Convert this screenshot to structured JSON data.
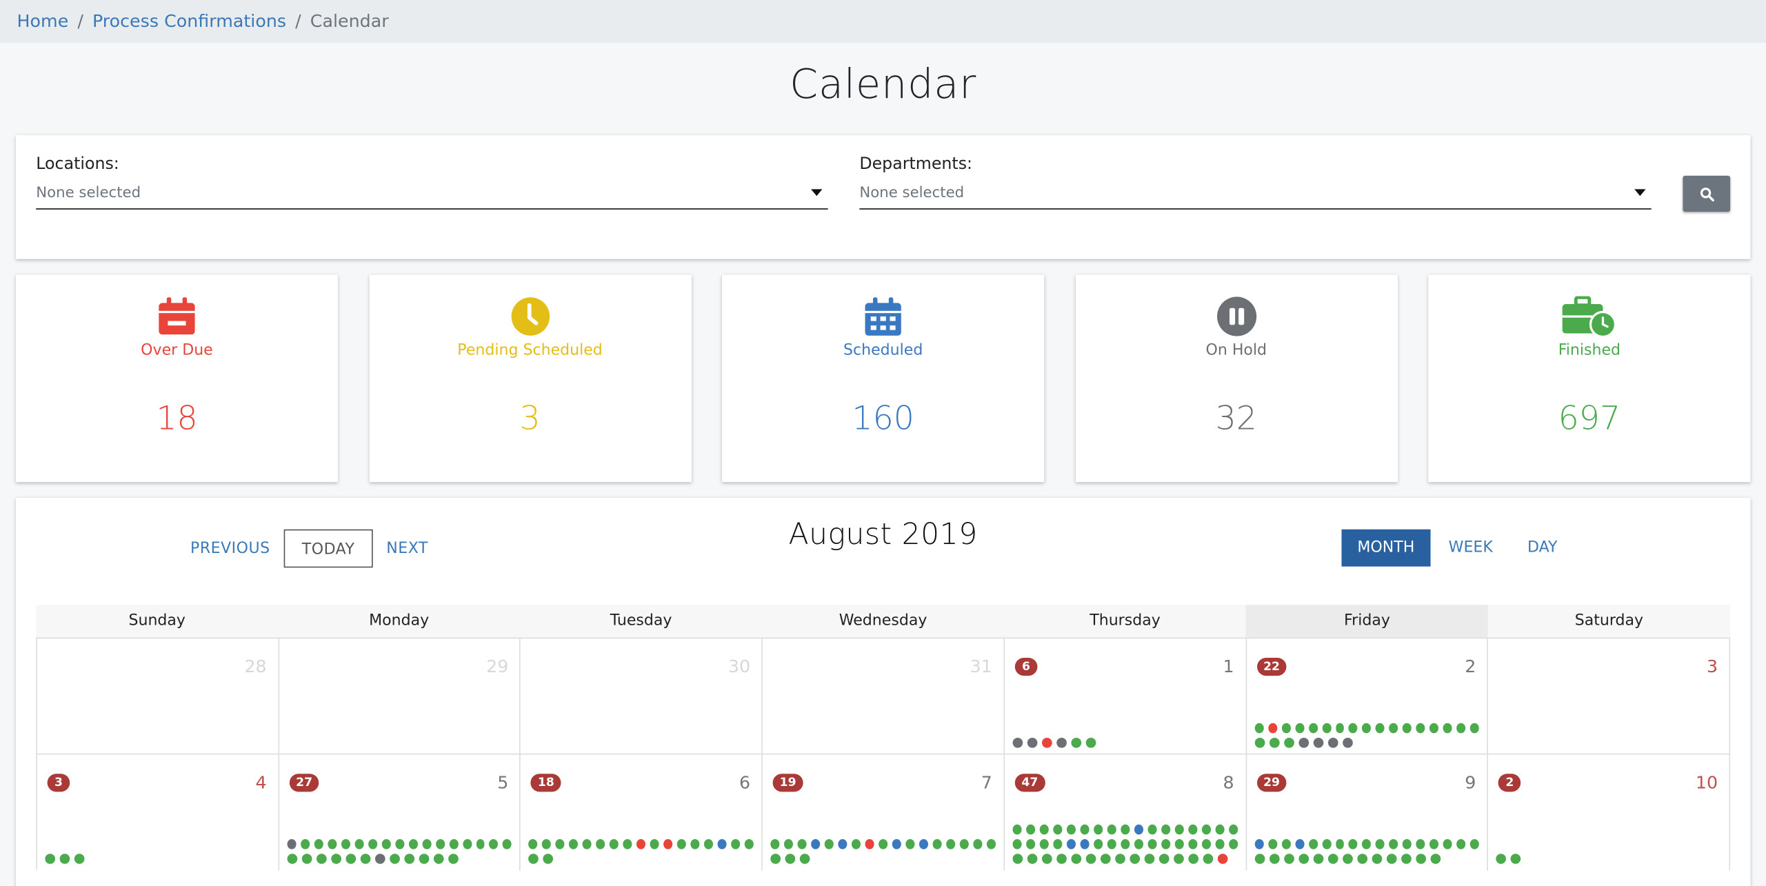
{
  "breadcrumb": {
    "home": "Home",
    "process": "Process Confirmations",
    "current": "Calendar",
    "sep": "/"
  },
  "page_title": "Calendar",
  "filters": {
    "locations": {
      "label": "Locations:",
      "value": "None selected"
    },
    "departments": {
      "label": "Departments:",
      "value": "None selected"
    }
  },
  "stats": [
    {
      "label": "Over Due",
      "value": "18",
      "color": "#e8443a",
      "icon": "calendar-minus-icon"
    },
    {
      "label": "Pending Scheduled",
      "value": "3",
      "color": "#e2be16",
      "icon": "clock-icon"
    },
    {
      "label": "Scheduled",
      "value": "160",
      "color": "#3a78c2",
      "icon": "calendar-grid-icon"
    },
    {
      "label": "On Hold",
      "value": "32",
      "color": "#6c6f73",
      "icon": "pause-icon"
    },
    {
      "label": "Finished",
      "value": "697",
      "color": "#4aaa4c",
      "icon": "briefcase-clock-icon"
    }
  ],
  "calendar": {
    "nav": {
      "previous": "PREVIOUS",
      "today": "TODAY",
      "next": "NEXT"
    },
    "title": "August 2019",
    "views": {
      "month": "MONTH",
      "week": "WEEK",
      "day": "DAY",
      "active": "month"
    },
    "weekdays": [
      "Sunday",
      "Monday",
      "Tuesday",
      "Wednesday",
      "Thursday",
      "Friday",
      "Saturday"
    ],
    "highlighted_weekday": "Friday",
    "dot_colors": {
      "g": "#4aaa4c",
      "r": "#e8443a",
      "b": "#3a78c2",
      "k": "#6c6f73"
    },
    "weeks": [
      [
        {
          "num": "28",
          "other": true
        },
        {
          "num": "29",
          "other": true
        },
        {
          "num": "30",
          "other": true
        },
        {
          "num": "31",
          "other": true
        },
        {
          "num": "1",
          "badge": "6",
          "dots": [
            "kkrkgg"
          ]
        },
        {
          "num": "2",
          "badge": "22",
          "dots": [
            "grggggggggggggggg",
            "gggkkkk"
          ]
        },
        {
          "num": "3",
          "weekend": true
        }
      ],
      [
        {
          "num": "4",
          "weekend": true,
          "badge": "3",
          "dots": [
            "ggg"
          ]
        },
        {
          "num": "5",
          "badge": "27",
          "dots": [
            "kgggggggggggggggg",
            "ggggggkggggg"
          ]
        },
        {
          "num": "6",
          "badge": "18",
          "dots": [
            "ggggggggrgrgggbgg",
            "gg"
          ]
        },
        {
          "num": "7",
          "badge": "19",
          "dots": [
            "gggbgbgrgbgbggggg",
            "ggg"
          ]
        },
        {
          "num": "8",
          "badge": "47",
          "dots": [
            "gggggggggbggggggg",
            "ggggbbggggggggggg",
            "ggggggggggggggr"
          ]
        },
        {
          "num": "9",
          "badge": "29",
          "dots": [
            "bggbggggggggggggg",
            "ggggggggggggg"
          ]
        },
        {
          "num": "10",
          "weekend": true,
          "badge": "2",
          "dots": [
            "gg"
          ]
        }
      ]
    ]
  }
}
